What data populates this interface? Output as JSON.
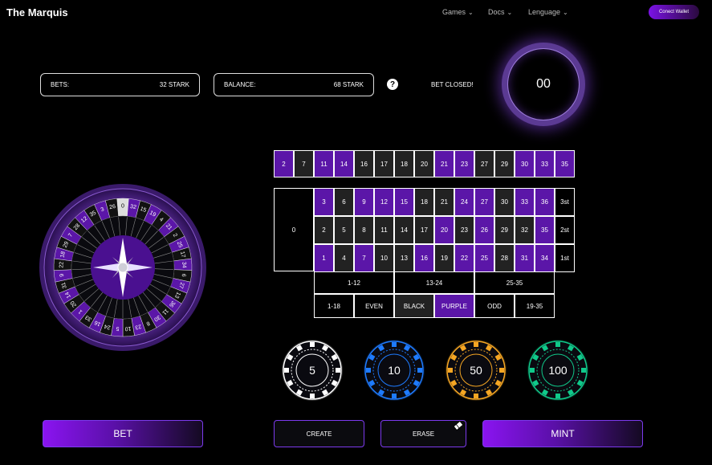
{
  "header": {
    "brand": "The Marquis",
    "nav": [
      {
        "label": "Games"
      },
      {
        "label": "Docs"
      },
      {
        "label": "Lenguage"
      }
    ],
    "wallet_label": "Conect Wallet"
  },
  "stats": {
    "bets_label": "BETS:",
    "bets_value": "32 STARK",
    "balance_label": "BALANCE:",
    "balance_value": "68 STARK",
    "help": "?",
    "status": "BET CLOSED!",
    "timer": "00"
  },
  "board": {
    "top_row": [
      {
        "n": "2",
        "c": "purple"
      },
      {
        "n": "7",
        "c": "black"
      },
      {
        "n": "11",
        "c": "purple"
      },
      {
        "n": "14",
        "c": "purple"
      },
      {
        "n": "16",
        "c": "black"
      },
      {
        "n": "17",
        "c": "black"
      },
      {
        "n": "18",
        "c": "black"
      },
      {
        "n": "20",
        "c": "black"
      },
      {
        "n": "21",
        "c": "purple"
      },
      {
        "n": "23",
        "c": "purple"
      },
      {
        "n": "27",
        "c": "black"
      },
      {
        "n": "29",
        "c": "black"
      },
      {
        "n": "30",
        "c": "purple"
      },
      {
        "n": "33",
        "c": "purple"
      },
      {
        "n": "35",
        "c": "purple"
      }
    ],
    "zero": "0",
    "rows": [
      [
        {
          "n": "3",
          "c": "purple"
        },
        {
          "n": "6",
          "c": "black"
        },
        {
          "n": "9",
          "c": "purple"
        },
        {
          "n": "12",
          "c": "purple"
        },
        {
          "n": "15",
          "c": "purple"
        },
        {
          "n": "18",
          "c": "black"
        },
        {
          "n": "21",
          "c": "black"
        },
        {
          "n": "24",
          "c": "purple"
        },
        {
          "n": "27",
          "c": "purple"
        },
        {
          "n": "30",
          "c": "black"
        },
        {
          "n": "33",
          "c": "purple"
        },
        {
          "n": "36",
          "c": "purple"
        }
      ],
      [
        {
          "n": "2",
          "c": "black"
        },
        {
          "n": "5",
          "c": "black"
        },
        {
          "n": "8",
          "c": "black"
        },
        {
          "n": "11",
          "c": "black"
        },
        {
          "n": "14",
          "c": "black"
        },
        {
          "n": "17",
          "c": "black"
        },
        {
          "n": "20",
          "c": "purple"
        },
        {
          "n": "23",
          "c": "black"
        },
        {
          "n": "26",
          "c": "purple"
        },
        {
          "n": "29",
          "c": "black"
        },
        {
          "n": "32",
          "c": "black"
        },
        {
          "n": "35",
          "c": "purple"
        }
      ],
      [
        {
          "n": "1",
          "c": "purple"
        },
        {
          "n": "4",
          "c": "black"
        },
        {
          "n": "7",
          "c": "purple"
        },
        {
          "n": "10",
          "c": "black"
        },
        {
          "n": "13",
          "c": "black"
        },
        {
          "n": "16",
          "c": "purple"
        },
        {
          "n": "19",
          "c": "black"
        },
        {
          "n": "22",
          "c": "purple"
        },
        {
          "n": "25",
          "c": "purple"
        },
        {
          "n": "28",
          "c": "black"
        },
        {
          "n": "31",
          "c": "purple"
        },
        {
          "n": "34",
          "c": "purple"
        }
      ]
    ],
    "columns": [
      "3st",
      "2st",
      "1st"
    ],
    "dozens": [
      "1-12",
      "13-24",
      "25-35"
    ],
    "outside": [
      {
        "label": "1-18",
        "c": "plain"
      },
      {
        "label": "EVEN",
        "c": "plain"
      },
      {
        "label": "BLACK",
        "c": "black"
      },
      {
        "label": "PURPLE",
        "c": "purple"
      },
      {
        "label": "ODD",
        "c": "plain"
      },
      {
        "label": "19-35",
        "c": "plain"
      }
    ]
  },
  "wheel": {
    "numbers": [
      "0",
      "32",
      "15",
      "19",
      "4",
      "21",
      "2",
      "25",
      "17",
      "34",
      "6",
      "27",
      "13",
      "36",
      "11",
      "30",
      "8",
      "23",
      "10",
      "5",
      "24",
      "16",
      "33",
      "1",
      "20",
      "14",
      "31",
      "9",
      "22",
      "18",
      "29",
      "7",
      "28",
      "12",
      "35",
      "3",
      "26"
    ]
  },
  "chips": [
    {
      "value": "5",
      "color": "#ffffff"
    },
    {
      "value": "10",
      "color": "#1e7bff"
    },
    {
      "value": "50",
      "color": "#f5a623"
    },
    {
      "value": "100",
      "color": "#10c98a"
    }
  ],
  "buttons": {
    "bet": "BET",
    "create": "CREATE",
    "erase": "ERASE",
    "mint": "MINT"
  },
  "colors": {
    "purple": "#5b16a8",
    "black": "#222222",
    "accent": "#7c3aed"
  }
}
